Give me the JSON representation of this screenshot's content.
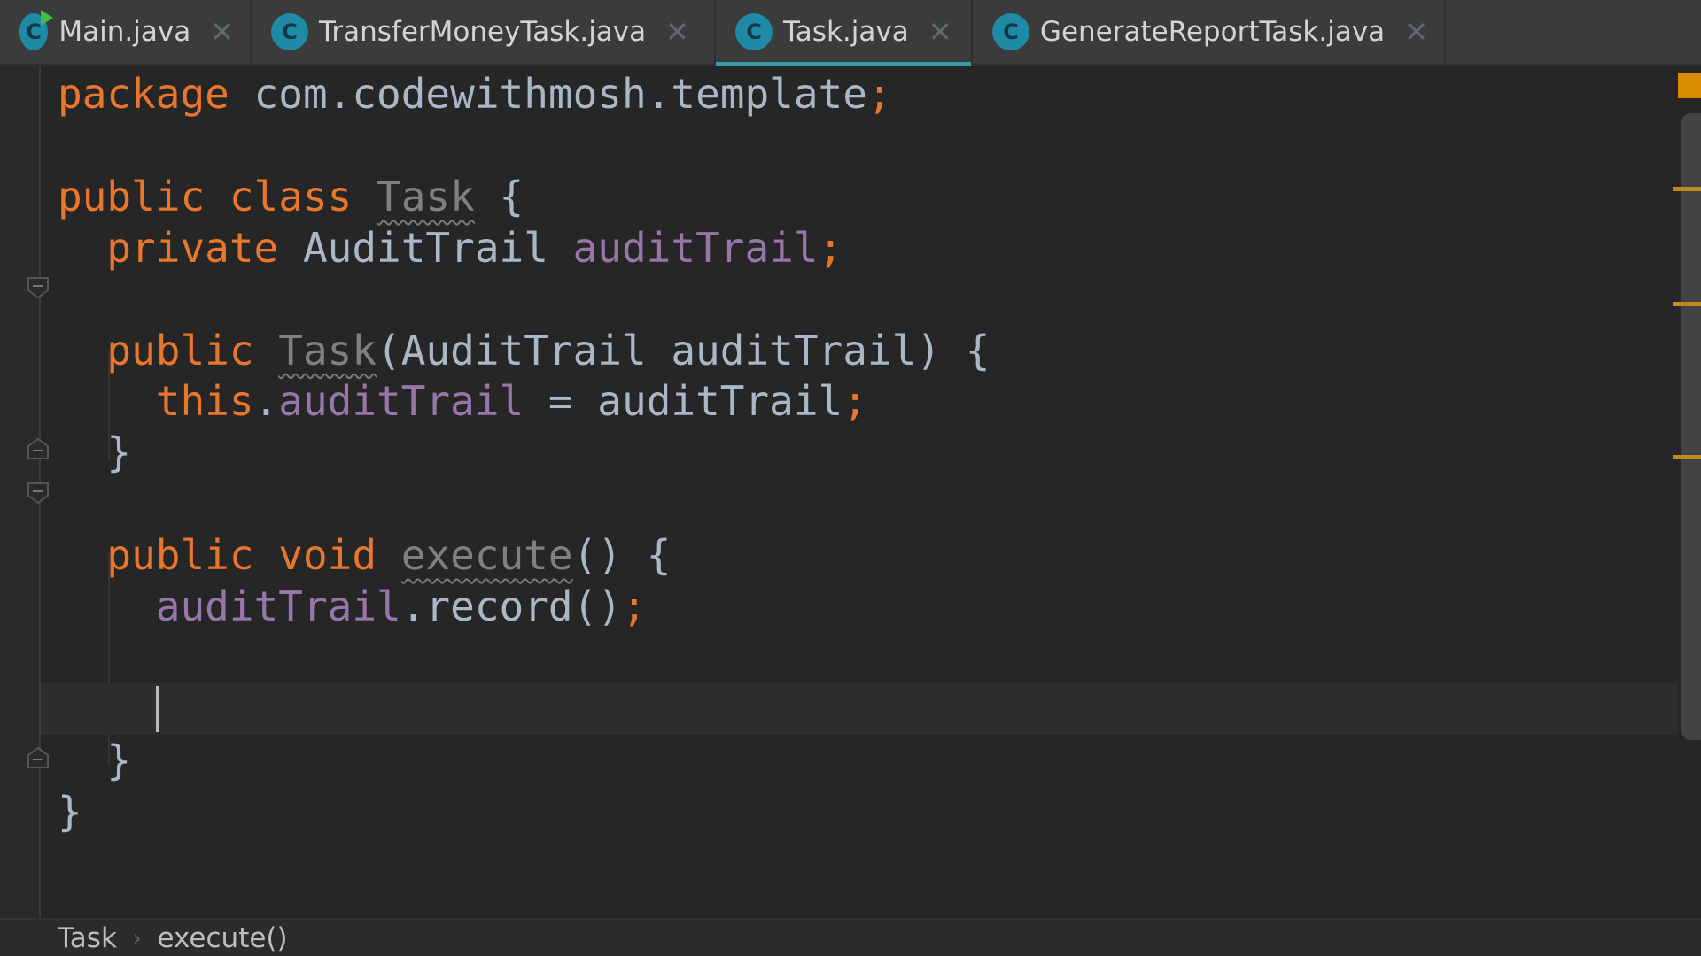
{
  "tabs": [
    {
      "label": "Main.java",
      "icon": "class-icon",
      "icon_letter": "C",
      "runnable": true,
      "active": false
    },
    {
      "label": "TransferMoneyTask.java",
      "icon": "class-icon",
      "icon_letter": "C",
      "runnable": false,
      "active": false
    },
    {
      "label": "Task.java",
      "icon": "class-icon",
      "icon_letter": "C",
      "runnable": false,
      "active": true
    },
    {
      "label": "GenerateReportTask.java",
      "icon": "class-icon",
      "icon_letter": "C",
      "runnable": false,
      "active": false
    }
  ],
  "close_glyph": "✕",
  "code": {
    "lines": [
      [
        [
          "package",
          "kw"
        ],
        [
          " com.codewithmosh.template",
          "id"
        ],
        [
          ";",
          "punct"
        ]
      ],
      [],
      [
        [
          "public class ",
          "kw"
        ],
        [
          "Task",
          "unused"
        ],
        [
          " {",
          "id"
        ]
      ],
      [
        [
          "  private ",
          "kw"
        ],
        [
          "AuditTrail ",
          "id"
        ],
        [
          "auditTrail",
          "field"
        ],
        [
          ";",
          "punct"
        ]
      ],
      [],
      [
        [
          "  public ",
          "kw"
        ],
        [
          "Task",
          "unused"
        ],
        [
          "(AuditTrail auditTrail) {",
          "id"
        ]
      ],
      [
        [
          "    this",
          "kw"
        ],
        [
          ".",
          "id"
        ],
        [
          "auditTrail",
          "field"
        ],
        [
          " = auditTrail",
          "id"
        ],
        [
          ";",
          "punct"
        ]
      ],
      [
        [
          "  }",
          "id"
        ]
      ],
      [],
      [
        [
          "  public void ",
          "kw"
        ],
        [
          "execute",
          "unused"
        ],
        [
          "() {",
          "id"
        ]
      ],
      [
        [
          "    ",
          "id"
        ],
        [
          "auditTrail",
          "field"
        ],
        [
          ".record()",
          "id"
        ],
        [
          ";",
          "punct"
        ]
      ],
      [],
      [],
      [
        [
          "  }",
          "id"
        ]
      ],
      [
        [
          "}",
          "id"
        ]
      ]
    ],
    "current_line": 12
  },
  "breadcrumbs": {
    "items": [
      "Task",
      "execute()"
    ],
    "separator": "›"
  },
  "colors": {
    "keyword": "#e8762d",
    "identifier": "#a9b7c6",
    "field": "#9876aa",
    "unused": "#808080",
    "active_tab": "#3a9aa8",
    "warning": "#d98a00"
  }
}
